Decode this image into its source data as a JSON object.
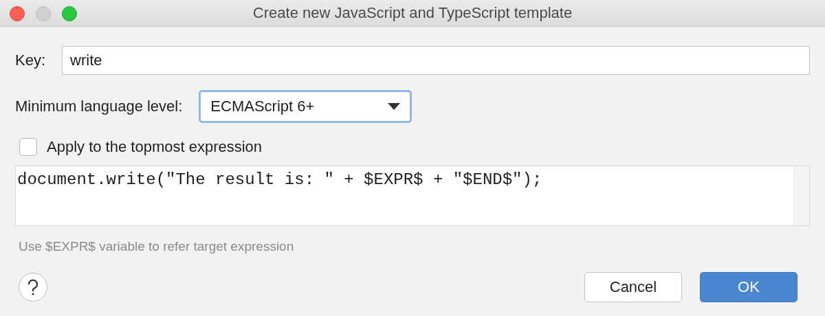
{
  "window": {
    "title": "Create new JavaScript and TypeScript template"
  },
  "key": {
    "label": "Key:",
    "value": "write"
  },
  "language_level": {
    "label": "Minimum language level:",
    "value": "ECMAScript 6+"
  },
  "apply_topmost": {
    "label": "Apply to the topmost expression",
    "checked": false
  },
  "template_text": "document.write(\"The result is: \" + $EXPR$ + \"$END$\");",
  "hint": "Use $EXPR$ variable to refer target expression",
  "buttons": [
    {
      "label": "Cancel",
      "kind": "secondary"
    },
    {
      "label": "OK",
      "kind": "primary"
    }
  ]
}
